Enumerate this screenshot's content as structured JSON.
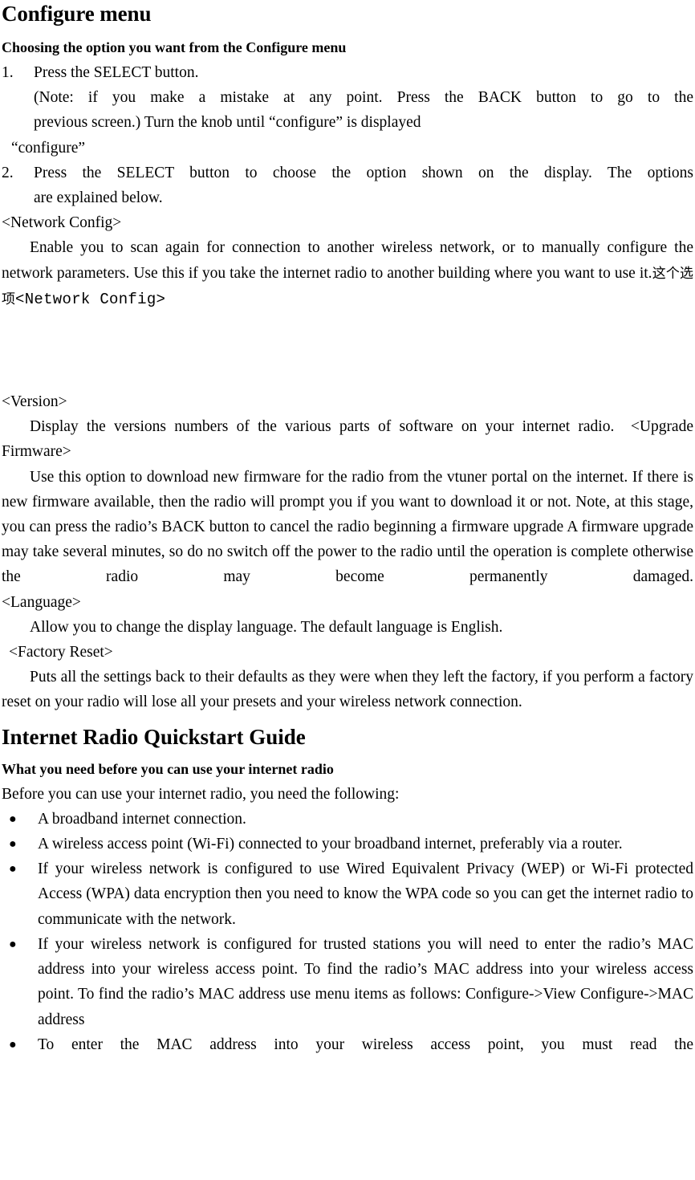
{
  "document": {
    "title": "Configure menu",
    "sections": [
      {
        "id": "configure-menu",
        "heading": "Configure menu",
        "subheading": "Choosing the option you want from the Configure menu",
        "steps": [
          {
            "marker": "1.",
            "lines": [
              "Press the SELECT button.",
              "(Note: if you make a mistake at any point. Press the BACK button to go to the",
              "previous screen.) Turn the knob until “configure” is displayed"
            ]
          },
          {
            "marker": "2.",
            "lines": [
              "Press the SELECT button to choose the option shown on the display. The options",
              "are explained below."
            ]
          }
        ],
        "configure_echo": "“configure”",
        "options": [
          {
            "label": "<Network Config>",
            "body": "Enable you to scan again for connection to another wireless network, or to manually configure the network parameters. Use this if you take the internet radio to another building where you want to use it.",
            "cjk_note": "这个选项",
            "mono_tag": "<Network Config>"
          },
          {
            "label": "<Version>",
            "body": "Display the versions numbers of the various parts of software on your internet radio.",
            "inline_next_label": "<Upgrade Firmware>"
          },
          {
            "label": "<Upgrade Firmware>",
            "body": "Use this option to download new firmware for the radio from the vtuner portal on the internet. If there is new firmware available, then the radio will prompt you if you want to download it or not. Note, at this stage, you can press the radio’s BACK button to cancel the radio beginning a firmware upgrade A firmware upgrade may take several minutes, so do no switch off the power to the radio until the operation is complete otherwise the radio may become permanently damaged."
          },
          {
            "label": "<Language>",
            "body": "Allow you to change the display language. The default language is English."
          },
          {
            "label": "<Factory Reset>",
            "body": "Puts all the settings back to their defaults as they were when they left the factory, if you perform a factory reset on your radio will lose all your presets and your wireless network connection."
          }
        ]
      },
      {
        "id": "quickstart-guide",
        "heading": "Internet Radio Quickstart Guide",
        "subheading": "What you need before you can use your internet radio",
        "intro": "Before you can use your internet radio, you need the following:",
        "bullet_glyph": "●",
        "bullets": [
          "A broadband internet connection.",
          "A wireless access point (Wi-Fi) connected to your broadband internet, preferably via a router.",
          "If your wireless network is configured to use Wired Equivalent Privacy (WEP) or Wi-Fi protected Access (WPA) data encryption then you need to know the WPA code so you can get the internet radio to communicate with the network.",
          "If your wireless network is configured for trusted stations you will need to enter the radio’s MAC address into your wireless access point. To find the radio’s MAC address into your wireless access point. To find the radio’s MAC address use menu items as follows: Configure->View Configure->MAC address",
          "To enter the MAC address into your wireless access point, you must read the"
        ]
      }
    ]
  }
}
